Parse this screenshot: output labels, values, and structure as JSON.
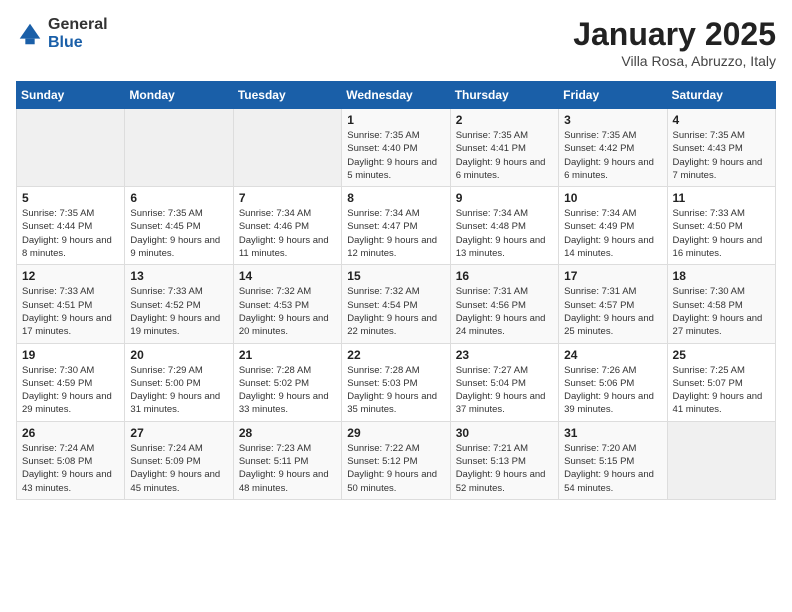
{
  "header": {
    "logo_general": "General",
    "logo_blue": "Blue",
    "month_title": "January 2025",
    "subtitle": "Villa Rosa, Abruzzo, Italy"
  },
  "weekdays": [
    "Sunday",
    "Monday",
    "Tuesday",
    "Wednesday",
    "Thursday",
    "Friday",
    "Saturday"
  ],
  "weeks": [
    [
      {
        "day": "",
        "info": ""
      },
      {
        "day": "",
        "info": ""
      },
      {
        "day": "",
        "info": ""
      },
      {
        "day": "1",
        "info": "Sunrise: 7:35 AM\nSunset: 4:40 PM\nDaylight: 9 hours and 5 minutes."
      },
      {
        "day": "2",
        "info": "Sunrise: 7:35 AM\nSunset: 4:41 PM\nDaylight: 9 hours and 6 minutes."
      },
      {
        "day": "3",
        "info": "Sunrise: 7:35 AM\nSunset: 4:42 PM\nDaylight: 9 hours and 6 minutes."
      },
      {
        "day": "4",
        "info": "Sunrise: 7:35 AM\nSunset: 4:43 PM\nDaylight: 9 hours and 7 minutes."
      }
    ],
    [
      {
        "day": "5",
        "info": "Sunrise: 7:35 AM\nSunset: 4:44 PM\nDaylight: 9 hours and 8 minutes."
      },
      {
        "day": "6",
        "info": "Sunrise: 7:35 AM\nSunset: 4:45 PM\nDaylight: 9 hours and 9 minutes."
      },
      {
        "day": "7",
        "info": "Sunrise: 7:34 AM\nSunset: 4:46 PM\nDaylight: 9 hours and 11 minutes."
      },
      {
        "day": "8",
        "info": "Sunrise: 7:34 AM\nSunset: 4:47 PM\nDaylight: 9 hours and 12 minutes."
      },
      {
        "day": "9",
        "info": "Sunrise: 7:34 AM\nSunset: 4:48 PM\nDaylight: 9 hours and 13 minutes."
      },
      {
        "day": "10",
        "info": "Sunrise: 7:34 AM\nSunset: 4:49 PM\nDaylight: 9 hours and 14 minutes."
      },
      {
        "day": "11",
        "info": "Sunrise: 7:33 AM\nSunset: 4:50 PM\nDaylight: 9 hours and 16 minutes."
      }
    ],
    [
      {
        "day": "12",
        "info": "Sunrise: 7:33 AM\nSunset: 4:51 PM\nDaylight: 9 hours and 17 minutes."
      },
      {
        "day": "13",
        "info": "Sunrise: 7:33 AM\nSunset: 4:52 PM\nDaylight: 9 hours and 19 minutes."
      },
      {
        "day": "14",
        "info": "Sunrise: 7:32 AM\nSunset: 4:53 PM\nDaylight: 9 hours and 20 minutes."
      },
      {
        "day": "15",
        "info": "Sunrise: 7:32 AM\nSunset: 4:54 PM\nDaylight: 9 hours and 22 minutes."
      },
      {
        "day": "16",
        "info": "Sunrise: 7:31 AM\nSunset: 4:56 PM\nDaylight: 9 hours and 24 minutes."
      },
      {
        "day": "17",
        "info": "Sunrise: 7:31 AM\nSunset: 4:57 PM\nDaylight: 9 hours and 25 minutes."
      },
      {
        "day": "18",
        "info": "Sunrise: 7:30 AM\nSunset: 4:58 PM\nDaylight: 9 hours and 27 minutes."
      }
    ],
    [
      {
        "day": "19",
        "info": "Sunrise: 7:30 AM\nSunset: 4:59 PM\nDaylight: 9 hours and 29 minutes."
      },
      {
        "day": "20",
        "info": "Sunrise: 7:29 AM\nSunset: 5:00 PM\nDaylight: 9 hours and 31 minutes."
      },
      {
        "day": "21",
        "info": "Sunrise: 7:28 AM\nSunset: 5:02 PM\nDaylight: 9 hours and 33 minutes."
      },
      {
        "day": "22",
        "info": "Sunrise: 7:28 AM\nSunset: 5:03 PM\nDaylight: 9 hours and 35 minutes."
      },
      {
        "day": "23",
        "info": "Sunrise: 7:27 AM\nSunset: 5:04 PM\nDaylight: 9 hours and 37 minutes."
      },
      {
        "day": "24",
        "info": "Sunrise: 7:26 AM\nSunset: 5:06 PM\nDaylight: 9 hours and 39 minutes."
      },
      {
        "day": "25",
        "info": "Sunrise: 7:25 AM\nSunset: 5:07 PM\nDaylight: 9 hours and 41 minutes."
      }
    ],
    [
      {
        "day": "26",
        "info": "Sunrise: 7:24 AM\nSunset: 5:08 PM\nDaylight: 9 hours and 43 minutes."
      },
      {
        "day": "27",
        "info": "Sunrise: 7:24 AM\nSunset: 5:09 PM\nDaylight: 9 hours and 45 minutes."
      },
      {
        "day": "28",
        "info": "Sunrise: 7:23 AM\nSunset: 5:11 PM\nDaylight: 9 hours and 48 minutes."
      },
      {
        "day": "29",
        "info": "Sunrise: 7:22 AM\nSunset: 5:12 PM\nDaylight: 9 hours and 50 minutes."
      },
      {
        "day": "30",
        "info": "Sunrise: 7:21 AM\nSunset: 5:13 PM\nDaylight: 9 hours and 52 minutes."
      },
      {
        "day": "31",
        "info": "Sunrise: 7:20 AM\nSunset: 5:15 PM\nDaylight: 9 hours and 54 minutes."
      },
      {
        "day": "",
        "info": ""
      }
    ]
  ]
}
